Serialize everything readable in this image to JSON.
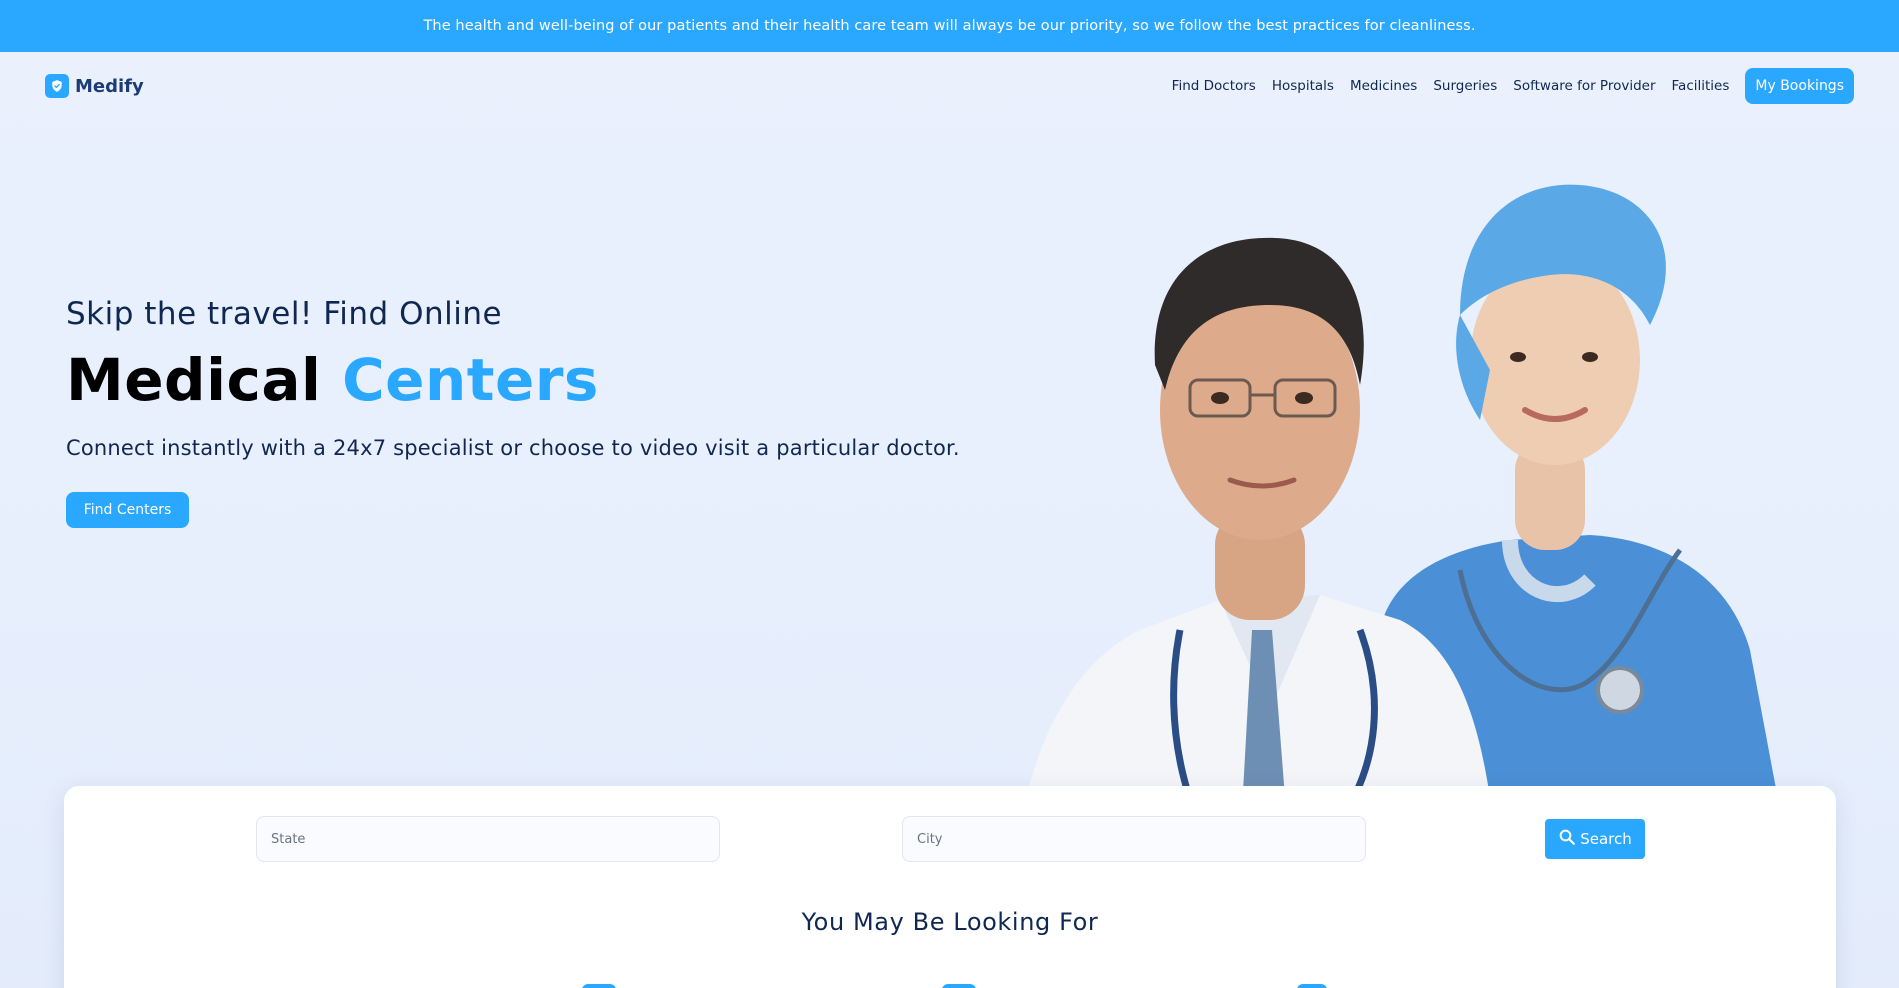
{
  "banner": {
    "text": "The health and well-being of our patients and their health care team will always be our priority, so we follow the best practices for cleanliness."
  },
  "brand": {
    "name": "Medify",
    "icon": "shield-check-icon",
    "accent_color": "#2aa7ff",
    "text_color": "#102851"
  },
  "nav": {
    "links": [
      "Find Doctors",
      "Hospitals",
      "Medicines",
      "Surgeries",
      "Software for Provider",
      "Facilities"
    ],
    "cta": "My Bookings"
  },
  "hero": {
    "subtitle": "Skip the travel! Find Online",
    "title_main": "Medical",
    "title_accent": "Centers",
    "description": "Connect instantly with a 24x7 specialist or choose to video visit a particular doctor.",
    "button": "Find Centers",
    "image": "doctor-and-nurse-illustration"
  },
  "search": {
    "state_placeholder": "State",
    "city_placeholder": "City",
    "button": "Search",
    "button_icon": "search-icon",
    "section_title": "You May Be Looking For"
  }
}
